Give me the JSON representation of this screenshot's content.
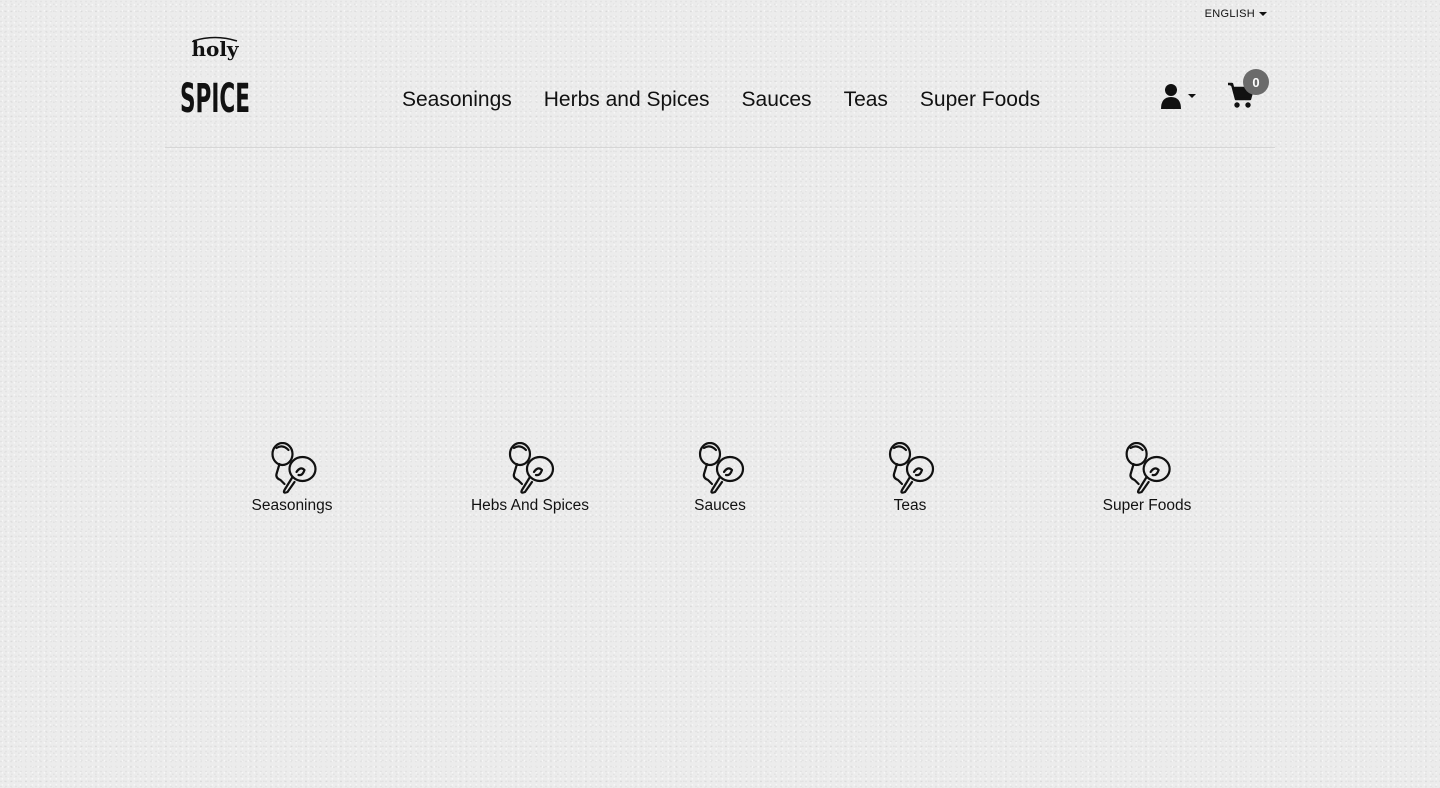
{
  "language": {
    "label": "ENGLISH"
  },
  "brand": {
    "logo_top": "holy",
    "logo_bottom": "SPICE"
  },
  "nav": {
    "items": [
      {
        "label": "Seasonings"
      },
      {
        "label": "Herbs and Spices"
      },
      {
        "label": "Sauces"
      },
      {
        "label": "Teas"
      },
      {
        "label": "Super Foods"
      }
    ]
  },
  "account": {
    "icon": "user-icon"
  },
  "cart": {
    "icon": "cart-icon",
    "count": "0"
  },
  "categories": [
    {
      "label": "Seasonings",
      "icon": "maracas-icon"
    },
    {
      "label": "Hebs And Spices",
      "icon": "maracas-icon"
    },
    {
      "label": "Sauces",
      "icon": "maracas-icon"
    },
    {
      "label": "Teas",
      "icon": "maracas-icon"
    },
    {
      "label": "Super Foods",
      "icon": "maracas-icon"
    }
  ]
}
